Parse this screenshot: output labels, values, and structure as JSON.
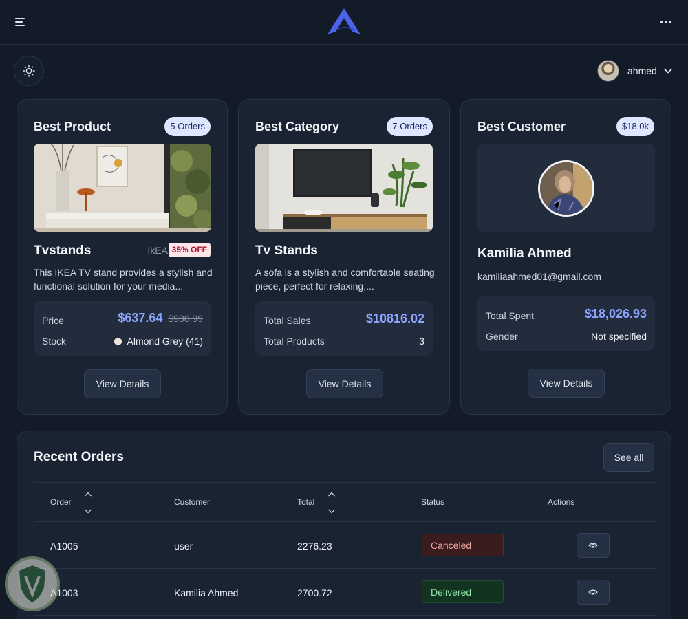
{
  "header": {
    "menu_icon": "menu-icon",
    "logo_icon": "logo-triangle-icon",
    "more_icon": "more-dots-icon"
  },
  "toolbar": {
    "theme_icon": "sun-icon",
    "user_name": "ahmed",
    "user_chevron_icon": "chevron-down-icon"
  },
  "best_product": {
    "title": "Best Product",
    "badge": "5 Orders",
    "name": "Tvstands",
    "brand": "IkEA",
    "discount": "35% OFF",
    "description": "This IKEA TV stand provides a stylish and functional solution for your media...",
    "price_label": "Price",
    "price": "$637.64",
    "old_price": "$980.99",
    "stock_label": "Stock",
    "stock_value": "Almond Grey (41)",
    "button": "View Details"
  },
  "best_category": {
    "title": "Best Category",
    "badge": "7 Orders",
    "name": "Tv Stands",
    "description": "A sofa is a stylish and comfortable seating piece, perfect for relaxing,...",
    "sales_label": "Total Sales",
    "sales_value": "$10816.02",
    "products_label": "Total Products",
    "products_value": "3",
    "button": "View Details"
  },
  "best_customer": {
    "title": "Best Customer",
    "badge": "$18.0k",
    "name": "Kamilia Ahmed",
    "email": "kamiliaahmed01@gmail.com",
    "spent_label": "Total Spent",
    "spent_value": "$18,026.93",
    "gender_label": "Gender",
    "gender_value": "Not specified",
    "button": "View Details"
  },
  "recent_orders": {
    "title": "Recent Orders",
    "see_all": "See all",
    "columns": [
      "Order",
      "Customer",
      "Total",
      "Status",
      "Actions"
    ],
    "rows": [
      {
        "order": "A1005",
        "customer": "user",
        "total": "2276.23",
        "status": "Canceled"
      },
      {
        "order": "A1003",
        "customer": "Kamilia Ahmed",
        "total": "2700.72",
        "status": "Delivered"
      }
    ]
  },
  "colors": {
    "background": "#131b29",
    "card": "#1a2332",
    "accent": "#8ea5ff",
    "logo": "#4a63e8",
    "badge_bg": "#dde7ff",
    "canceled": "#f1a7a3",
    "delivered": "#8fe7a8"
  }
}
